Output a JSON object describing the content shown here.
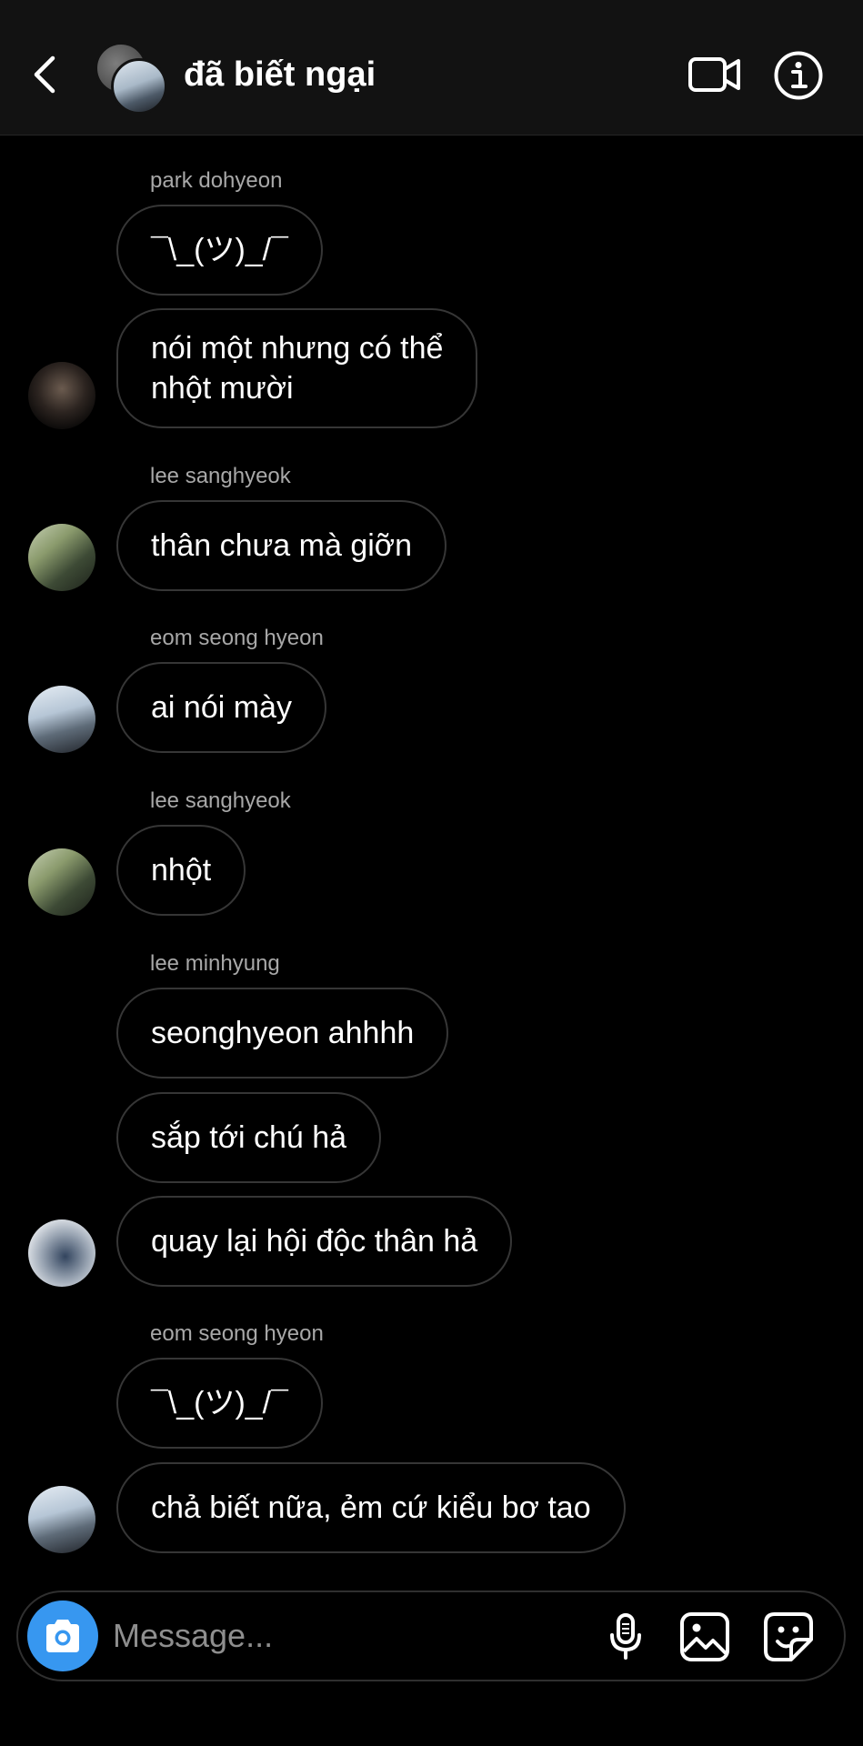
{
  "header": {
    "title": "đã biết ngại",
    "back_icon": "chevron-left-icon",
    "video_icon": "video-camera-icon",
    "info_icon": "info-icon"
  },
  "thread": {
    "senders": [
      "park dohyeon",
      "lee sanghyeok",
      "eom seong hyeon",
      "lee sanghyeok",
      "lee minhyung",
      "eom seong hyeon"
    ],
    "messages": [
      "¯\\_(ツ)_/¯",
      "nói một nhưng có thể\nnhột mười",
      "thân chưa mà giỡn",
      "ai nói mày",
      "nhột",
      "seonghyeon ahhhh",
      "sắp tới chú hả",
      "quay lại hội độc thân hả",
      "¯\\_(ツ)_/¯",
      "chả biết nữa, ẻm cứ kiểu bơ tao"
    ]
  },
  "composer": {
    "placeholder": "Message...",
    "camera_icon": "camera-icon",
    "mic_icon": "microphone-icon",
    "gallery_icon": "gallery-icon",
    "sticker_icon": "sticker-icon",
    "accent_color": "#3797f0"
  }
}
